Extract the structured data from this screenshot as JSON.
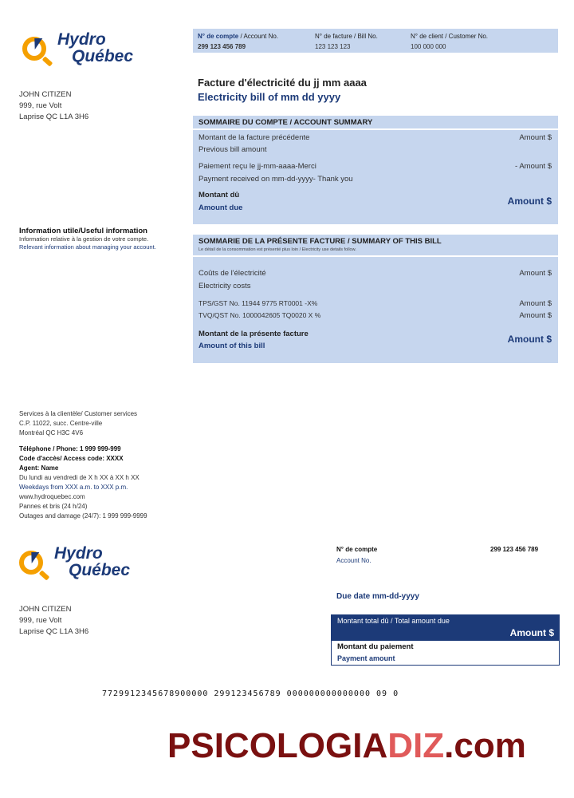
{
  "logo": {
    "line1": "Hydro",
    "line2": "Québec"
  },
  "customer": {
    "name": "JOHN CITIZEN",
    "street": "999, rue Volt",
    "city": "Laprise  QC L1A 3H6"
  },
  "header": {
    "account": {
      "label_fr": "N° de compte",
      "label_en": "/ Account  No.",
      "value": "299 123 456 789"
    },
    "bill": {
      "label_fr": "N° de facture",
      "label_en": "/ Bill No.",
      "value": "123 123 123"
    },
    "client": {
      "label_fr": "N° de client",
      "label_en": "/ Customer  No.",
      "value": "100 000 000"
    }
  },
  "title": {
    "fr": "Facture d'électricité  du jj mm aaaa",
    "en": "Electricity  bill of mm dd yyyy"
  },
  "account_summary": {
    "heading": "SOMMAIRE DU COMPTE / ACCOUNT SUMMARY",
    "previous_fr": "Montant  de la facture précédente",
    "previous_en": "Previous  bill amount",
    "previous_value": "Amount  $",
    "payment_fr": "Paiement  reçu  le jj-mm-aaaa-Merci",
    "payment_en": "Payment  received  on mm-dd-yyyy-  Thank  you",
    "payment_value": "- Amount  $",
    "due_fr": "Montant  dû",
    "due_en": "Amount due",
    "due_value": "Amount $"
  },
  "useful_info": {
    "title": "Information  utile/Useful  information",
    "line1": "Information relative à la gestion de votre compte.",
    "line2": "Relevant information about managing your account."
  },
  "bill_summary": {
    "heading": "SOMMARIE DE LA PRÉSENTE  FACTURE / SUMMARY OF THIS BILL",
    "subheading": "Le détail de la consommation est présenté plus loin / Electricity use details follow.",
    "costs_fr": "Coûts de l'électricité",
    "costs_en": "Electricity  costs",
    "costs_value": "Amount  $",
    "gst": "TPS/GST  No. 11944 9775 RT0001 -X%",
    "gst_value": "Amount  $",
    "qst": "TVQ/QST  No. 1000042605 TQ0020 X %",
    "qst_value": "Amount  $",
    "total_fr": "Montant  de la présente  facture",
    "total_en": "Amount  of this  bill",
    "total_value": "Amount $"
  },
  "services": {
    "line1": "Services à la clientèle/  Customer  services",
    "line2": "C.P.  11022,  succ.  Centre-ville",
    "line3": "Montréal  QC H3C 4V6",
    "phone": "Téléphone / Phone:  1 999 999-999",
    "access": "Code d'accès/ Access code: XXXX",
    "agent": "Agent: Name",
    "hours_fr": "Du lundi au vendredi  de X h XX à XX h XX",
    "hours_en": "Weekdays  from  XXX a.m. to XXX p.m.",
    "web": "www.hydroquebec.com",
    "outage_fr": "Pannes  et bris (24 h/24)",
    "outage_en": "Outages  and damage (24/7): 1 999 999-9999"
  },
  "stub": {
    "account_label_fr": "N° de compte",
    "account_label_en": "Account  No.",
    "account_value": "299 123 456 789",
    "due_date": "Due date mm-dd-yyyy",
    "total_label": "Montant  total dû / Total  amount  due",
    "total_value": "Amount $",
    "payment_fr": "Montant  du paiement",
    "payment_en": "Payment  amount"
  },
  "barcode_line": "7729912345678900000  299123456789  000000000000000  09  0",
  "watermark": {
    "part1": "PSICOLOGIA",
    "part2": "DIZ",
    "part3": ".com"
  },
  "colors": {
    "navy": "#1c3a78",
    "light_blue": "#c6d6ee",
    "logo_orange": "#f5a000",
    "watermark_red": "#7a1010"
  }
}
